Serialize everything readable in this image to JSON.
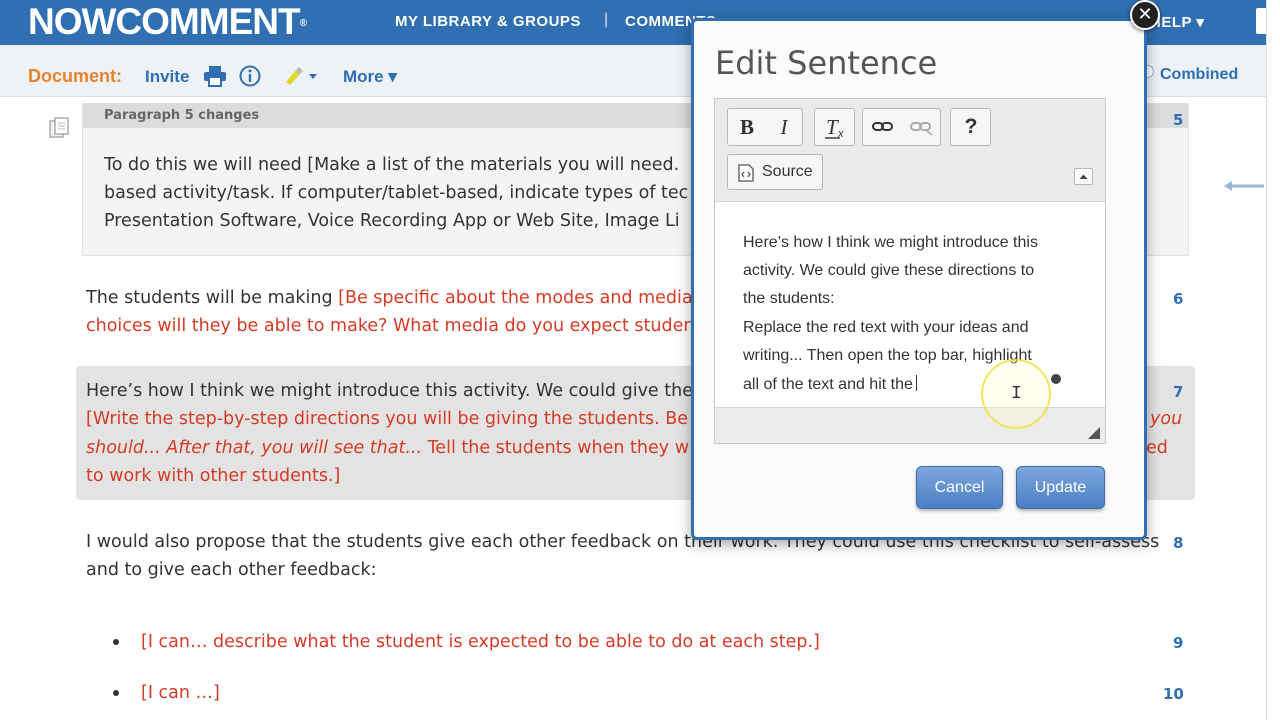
{
  "nav": {
    "logo": "NOWCOMMENT",
    "logo_mark": "®",
    "library": "MY LIBRARY & GROUPS",
    "separator": "|",
    "comments": "COMMENTS",
    "help": "HELP ▾"
  },
  "toolbar": {
    "document_label": "Document:",
    "invite": "Invite",
    "more": "More ▾",
    "combined": "Combined"
  },
  "document": {
    "paragraph_header": "Paragraph 5 changes",
    "para5": {
      "line1": "To do this we will need [Make a list of the materials you will need.",
      "line2": "based activity/task. If computer/tablet-based, indicate types of tec",
      "line3": "Presentation Software, Voice Recording App or Web Site, Image Li",
      "num": "5"
    },
    "para6": {
      "line1_black": "The students will be making ",
      "line1_red": "[Be specific about the modes and media",
      "line2_red": "choices will they be able to make? What media do you expect studen",
      "num": "6"
    },
    "para7": {
      "line1": "Here’s how I think we might introduce this activity. We could give the",
      "line2_red": "[Write the step-by-step directions you will be giving the students. Be",
      "line2_right": "you",
      "line3_italic": "should... After that, you will see that...",
      "line3_red": " Tell the students when they w",
      "line3_right": "ed",
      "line4_red": "to work with other students.]",
      "num": "7"
    },
    "para8": {
      "line1": "I would also propose that the students give each other feedback on their work. They could use this checklist to self-assess",
      "line2": "and to give each other feedback:",
      "num": "8"
    },
    "bullet9": {
      "text": "[I can… describe what the student is expected to be able to do at each step.]",
      "num": "9"
    },
    "bullet10": {
      "text": "[I can …]",
      "num": "10"
    }
  },
  "modal": {
    "title": "Edit Sentence",
    "close": "✕",
    "editor": {
      "bold": "B",
      "italic": "I",
      "clear_format": "Tx",
      "help": "?",
      "source": "Source",
      "text_black_1": "Here’s how I think we might introduce this",
      "text_black_2": "activity. We could give these directions to",
      "text_black_3": "the students:",
      "text_red_1": "Replace the red text with your ideas and",
      "text_red_2": "writing... Then open the top bar, highlight",
      "text_red_3": "all of the text and hit the"
    },
    "cancel": "Cancel",
    "update": "Update"
  },
  "colors": {
    "brand_blue": "#2f6fb2",
    "accent_orange": "#e8832a",
    "red_text": "#d63b25"
  }
}
